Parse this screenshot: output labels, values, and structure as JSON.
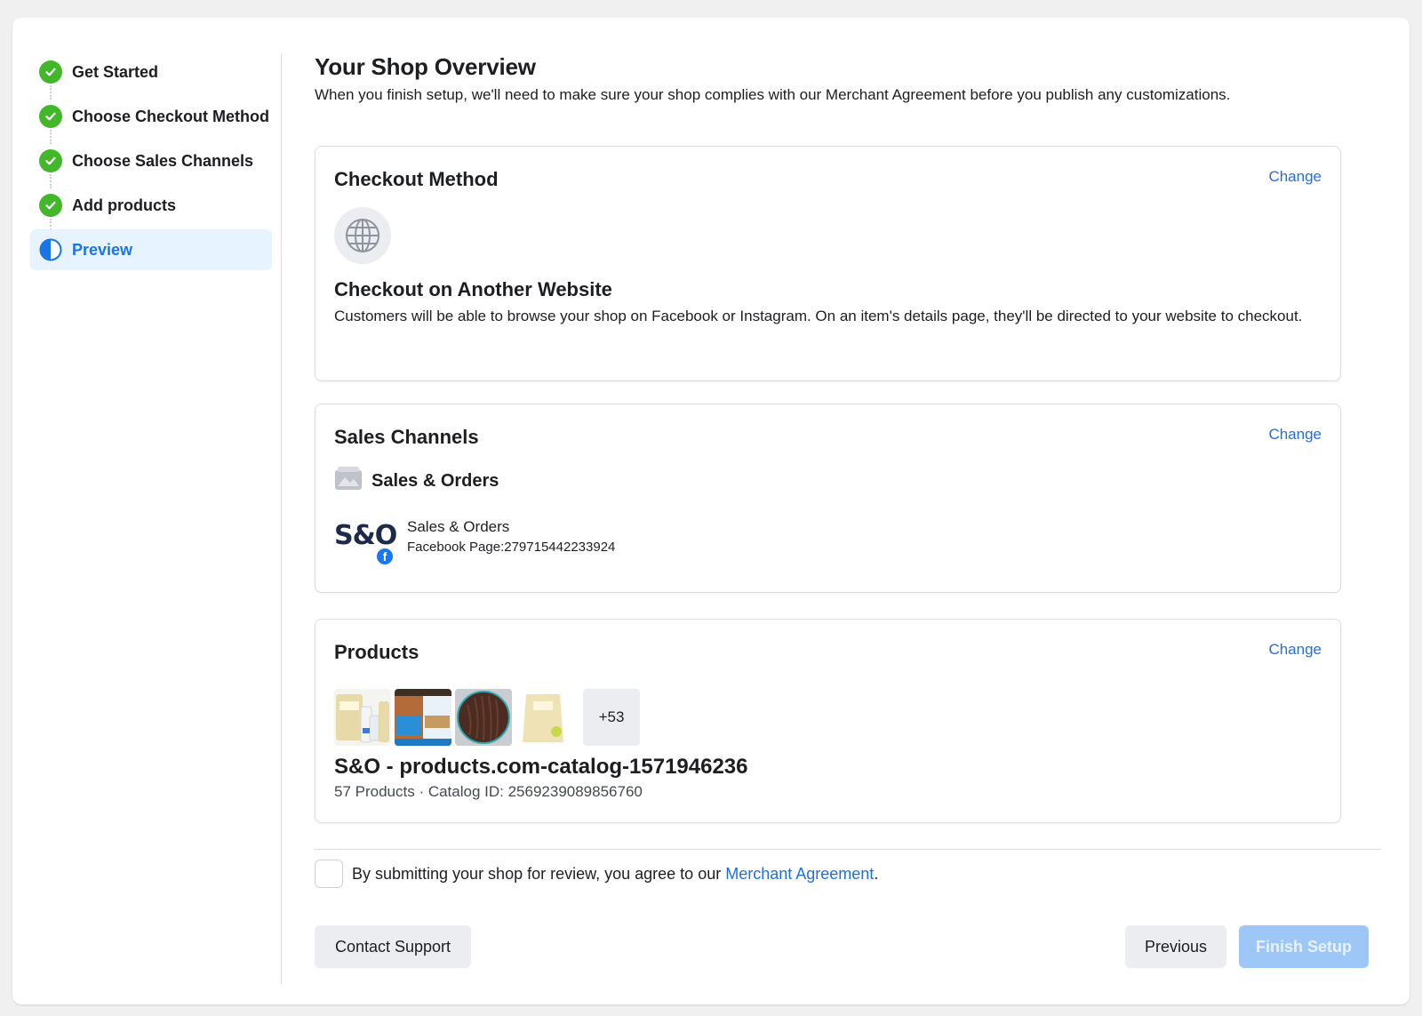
{
  "sidebar": {
    "steps": [
      {
        "label": "Get Started",
        "state": "done"
      },
      {
        "label": "Choose Checkout Method",
        "state": "done"
      },
      {
        "label": "Choose Sales Channels",
        "state": "done"
      },
      {
        "label": "Add products",
        "state": "done"
      },
      {
        "label": "Preview",
        "state": "active"
      }
    ]
  },
  "header": {
    "title": "Your Shop Overview",
    "subtitle": "When you finish setup, we'll need to make sure your shop complies with our Merchant Agreement before you publish any customizations."
  },
  "checkout_card": {
    "title": "Checkout Method",
    "change_label": "Change",
    "icon": "globe-icon",
    "method_name": "Checkout on Another Website",
    "method_desc": "Customers will be able to browse your shop on Facebook or Instagram. On an item's details page, they'll be directed to your website to checkout."
  },
  "sales_card": {
    "title": "Sales Channels",
    "change_label": "Change",
    "shop_name": "Sales & Orders",
    "channel": {
      "logo_text": "S&O",
      "name": "Sales & Orders",
      "page_id": "Facebook Page:279715442233924"
    }
  },
  "products_card": {
    "title": "Products",
    "change_label": "Change",
    "more_count": "+53",
    "catalog_name": "S&O - products.com-catalog-1571946236",
    "catalog_meta": "57 Products · Catalog ID: 2569239089856760"
  },
  "footer": {
    "agree_prefix": "By submitting your shop for review, you agree to our ",
    "agree_link": "Merchant Agreement",
    "agree_suffix": ".",
    "contact_support": "Contact Support",
    "previous": "Previous",
    "finish": "Finish Setup"
  },
  "colors": {
    "accent": "#216fdb",
    "success": "#42b72a",
    "active_bg": "#e7f3ff",
    "disabled_primary": "#9cc7f7"
  }
}
